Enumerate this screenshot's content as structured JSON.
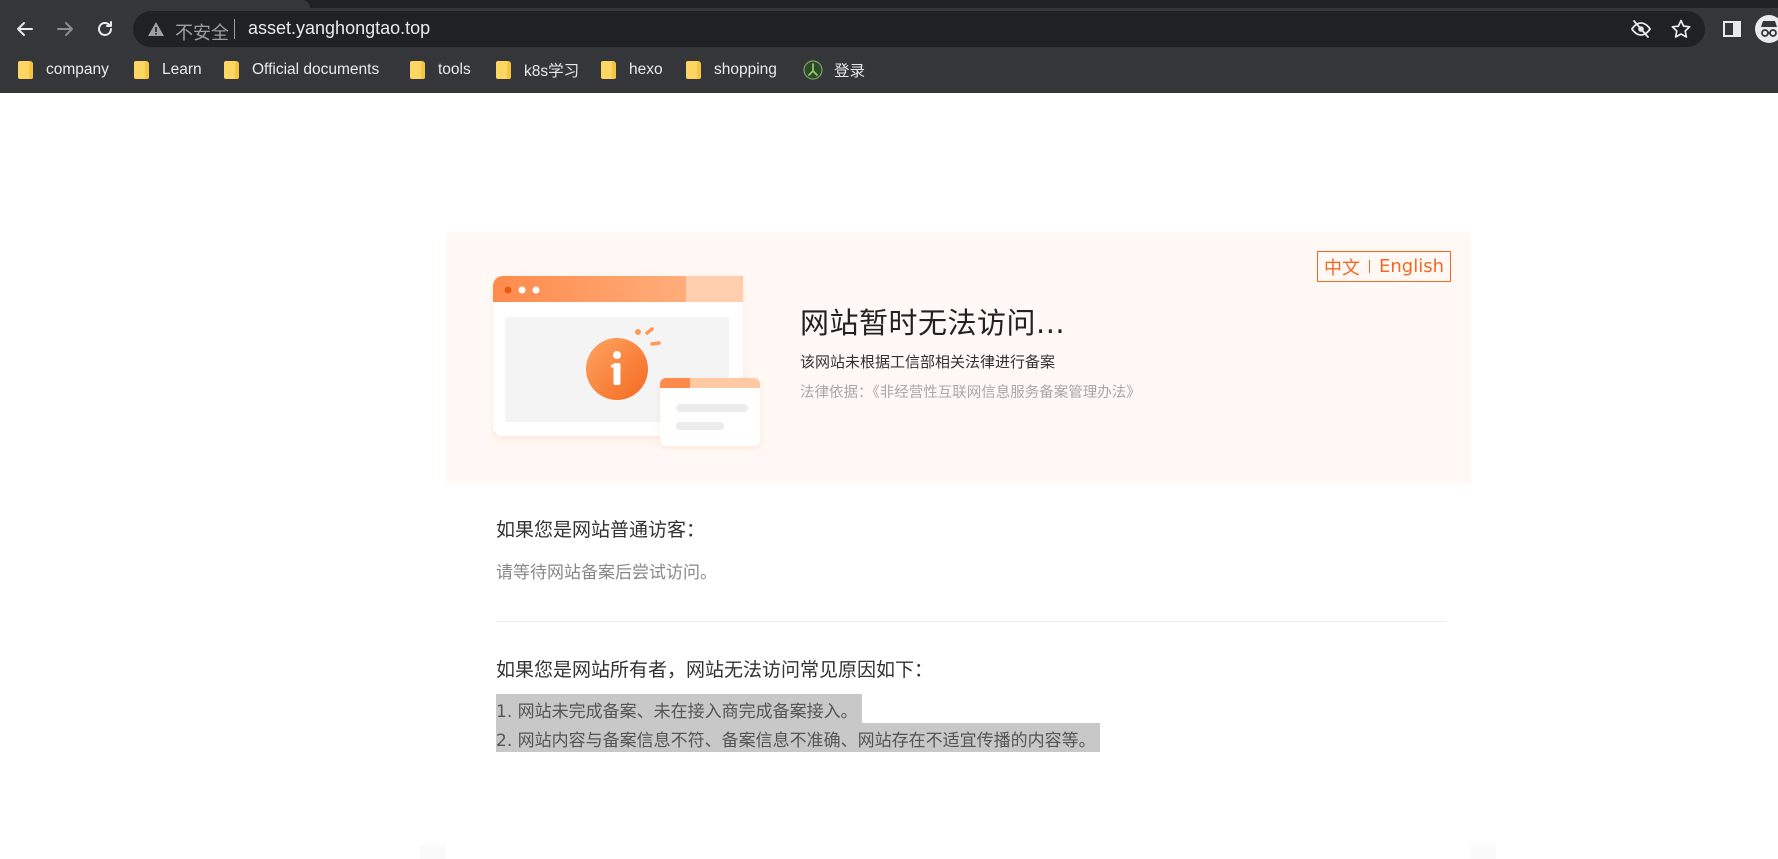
{
  "browser": {
    "address_bar": {
      "security_label": "不安全",
      "url": "asset.yanghongtao.top"
    },
    "icons": {
      "back": "back-arrow-icon",
      "forward": "forward-arrow-icon",
      "reload": "reload-icon",
      "warning": "warning-triangle-icon",
      "tracking": "eye-off-icon",
      "bookmark": "star-icon",
      "side_panel": "side-panel-icon",
      "profile": "incognito-icon"
    },
    "bookmarks": [
      {
        "label": "company",
        "icon": "folder-icon"
      },
      {
        "label": "Learn",
        "icon": "folder-icon"
      },
      {
        "label": "Official documents",
        "icon": "folder-icon"
      },
      {
        "label": "tools",
        "icon": "folder-icon"
      },
      {
        "label": "k8s学习",
        "icon": "folder-icon"
      },
      {
        "label": "hexo",
        "icon": "folder-icon"
      },
      {
        "label": "shopping",
        "icon": "folder-icon"
      },
      {
        "label": "登录",
        "icon": "login-site-icon"
      }
    ]
  },
  "page": {
    "lang_switch": {
      "chinese": "中文",
      "english": "English"
    },
    "headline": "网站暂时无法访问...",
    "subline": "该网站未根据工信部相关法律进行备案",
    "legal_basis": "法律依据：《非经营性互联网信息服务备案管理办法》",
    "visitor": {
      "title": "如果您是网站普通访客：",
      "text": "请等待网站备案后尝试访问。"
    },
    "owner": {
      "title": "如果您是网站所有者，网站无法访问常见原因如下：",
      "reasons": [
        "1. 网站未完成备案、未在接入商完成备案接入。",
        "2. 网站内容与备案信息不符、备案信息不准确、网站存在不适宜传播的内容等。"
      ]
    },
    "colors": {
      "accent": "#f26a21",
      "card_background": "#fff8f4",
      "selection_highlight": "#c8c8c8"
    }
  }
}
